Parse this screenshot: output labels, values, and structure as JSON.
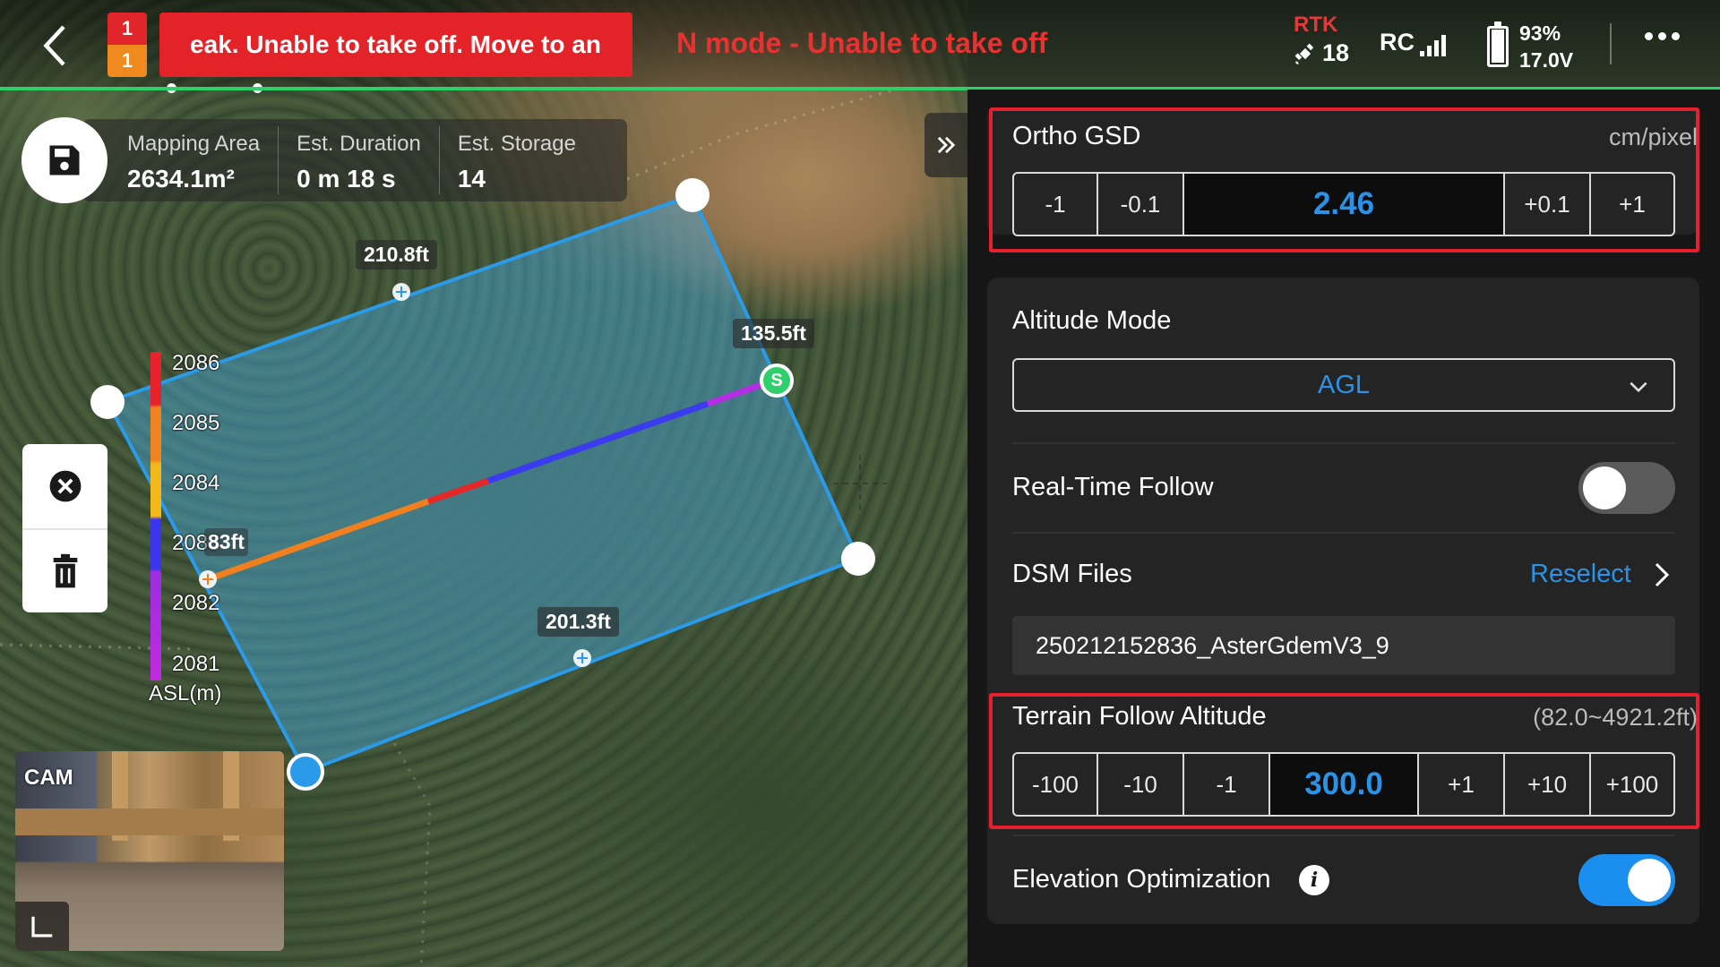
{
  "topbar": {
    "badge_top": "1",
    "badge_bottom": "1",
    "warning_banner": "eak. Unable to take off. Move to an",
    "warning_secondary": "N mode - Unable to take off",
    "rtk_label": "RTK",
    "rtk_satellites": "18",
    "rc_label": "RC",
    "battery_percent": "93%",
    "battery_voltage": "17.0V",
    "battery_level": 0.93,
    "colors": {
      "alert_red": "#e42329",
      "warning_orange": "#ef8a1f",
      "status_green": "#2fd068"
    }
  },
  "info_bar": {
    "items": [
      {
        "label": "Mapping Area",
        "value": "2634.1m²"
      },
      {
        "label": "Est. Duration",
        "value": "0 m 18 s"
      },
      {
        "label": "Est. Storage",
        "value": "14"
      }
    ]
  },
  "map": {
    "distance_labels": [
      "210.8ft",
      "135.5ft",
      "201.3ft",
      "83ft"
    ],
    "start_marker": "S",
    "legend": {
      "ticks": [
        "2086",
        "2085",
        "2084",
        "2083",
        "2082",
        "2081"
      ],
      "unit": "ASL(m)"
    },
    "camera_label": "CAM"
  },
  "panel": {
    "ortho_gsd": {
      "title": "Ortho GSD",
      "unit": "cm/pixel",
      "buttons": [
        "-1",
        "-0.1",
        "+0.1",
        "+1"
      ],
      "value": "2.46"
    },
    "altitude_mode": {
      "title": "Altitude Mode",
      "selected": "AGL"
    },
    "real_time_follow": {
      "title": "Real-Time Follow",
      "enabled": false
    },
    "dsm_files": {
      "title": "DSM Files",
      "action": "Reselect",
      "file": "250212152836_AsterGdemV3_9"
    },
    "terrain_follow": {
      "title": "Terrain Follow Altitude",
      "range": "(82.0~4921.2ft)",
      "buttons": [
        "-100",
        "-10",
        "-1",
        "+1",
        "+10",
        "+100"
      ],
      "value": "300.0"
    },
    "elevation_optimization": {
      "title": "Elevation Optimization",
      "info_icon": "info-icon",
      "enabled": true
    },
    "accent_color": "#2a93e8",
    "highlight_color": "#e51f2e"
  }
}
